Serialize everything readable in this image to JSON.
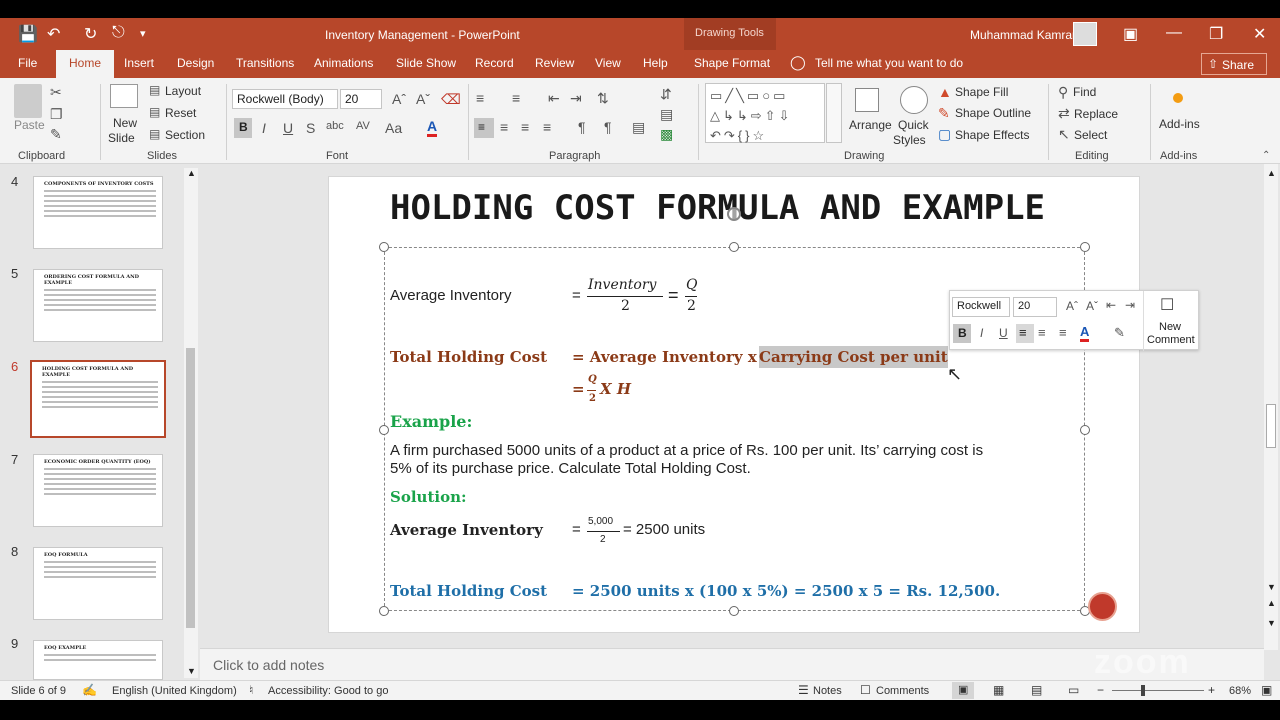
{
  "window": {
    "title": "Inventory Management  -  PowerPoint",
    "drawing_tools": "Drawing Tools",
    "user": "Muhammad Kamran"
  },
  "tabs": [
    "File",
    "Home",
    "Insert",
    "Design",
    "Transitions",
    "Animations",
    "Slide Show",
    "Record",
    "Review",
    "View",
    "Help",
    "Shape Format"
  ],
  "tell_me": "Tell me what you want to do",
  "share": "Share",
  "ribbon": {
    "clipboard": {
      "label": "Clipboard",
      "paste": "Paste"
    },
    "slides": {
      "label": "Slides",
      "new_slide": "New",
      "new_slide2": "Slide",
      "layout": "Layout",
      "reset": "Reset",
      "section": "Section"
    },
    "font": {
      "label": "Font",
      "name": "Rockwell (Body)",
      "size": "20"
    },
    "paragraph": {
      "label": "Paragraph"
    },
    "drawing": {
      "label": "Drawing",
      "arrange": "Arrange",
      "quick_styles": "Quick",
      "quick_styles2": "Styles",
      "shape_fill": "Shape Fill",
      "shape_outline": "Shape Outline",
      "shape_effects": "Shape Effects"
    },
    "editing": {
      "label": "Editing",
      "find": "Find",
      "replace": "Replace",
      "select": "Select"
    },
    "addins": {
      "label": "Add-ins",
      "button": "Add-ins"
    }
  },
  "thumbnails": [
    {
      "num": "4",
      "title": "COMPONENTS OF INVENTORY COSTS"
    },
    {
      "num": "5",
      "title": "ORDERING COST FORMULA AND EXAMPLE"
    },
    {
      "num": "6",
      "title": "HOLDING COST FORMULA AND EXAMPLE"
    },
    {
      "num": "7",
      "title": "ECONOMIC ORDER QUANTITY (EOQ)"
    },
    {
      "num": "8",
      "title": "EOQ FORMULA"
    },
    {
      "num": "9",
      "title": "EOQ EXAMPLE"
    }
  ],
  "slide": {
    "title": "HOLDING COST FORMULA AND EXAMPLE",
    "avg_inv_label": "Average Inventory",
    "eq1": "=",
    "frac1_num": "Inventory",
    "frac1_den": "2",
    "eq2": "=",
    "frac2_num": "Q",
    "frac2_den": "2",
    "thc_label": "Total Holding Cost",
    "thc_formula_a": "= Average Inventory x ",
    "thc_formula_b": "Carrying Cost per unit",
    "thc_eq": "=",
    "thc_q": "Q",
    "thc_2": "2",
    "thc_xh": "X H",
    "example_label": "Example:",
    "example_text1": "A firm purchased 5000 units of a product at a price of Rs. 100 per unit. Its’ carrying cost is",
    "example_text2": "5% of its purchase price. Calculate Total Holding Cost.",
    "solution_label": "Solution:",
    "sol_avg_label": "Average Inventory",
    "sol_eq": "=",
    "sol_num": "5,000",
    "sol_den": "2",
    "sol_result": "= 2500 units",
    "sol_thc_label": "Total Holding Cost",
    "sol_thc_value": "= 2500 units x (100 x 5%) = 2500 x 5 = Rs. 12,500."
  },
  "mini_toolbar": {
    "font": "Rockwell",
    "size": "20",
    "new_comment1": "New",
    "new_comment2": "Comment"
  },
  "notes_placeholder": "Click to add notes",
  "status": {
    "slide": "Slide 6 of 9",
    "language": "English (United Kingdom)",
    "accessibility": "Accessibility: Good to go",
    "notes": "Notes",
    "comments": "Comments",
    "zoom": "68%"
  },
  "colors": {
    "accent": "#b7472a",
    "brown": "#8b3a17",
    "green": "#1aa34a",
    "blue": "#1f6fa8"
  }
}
